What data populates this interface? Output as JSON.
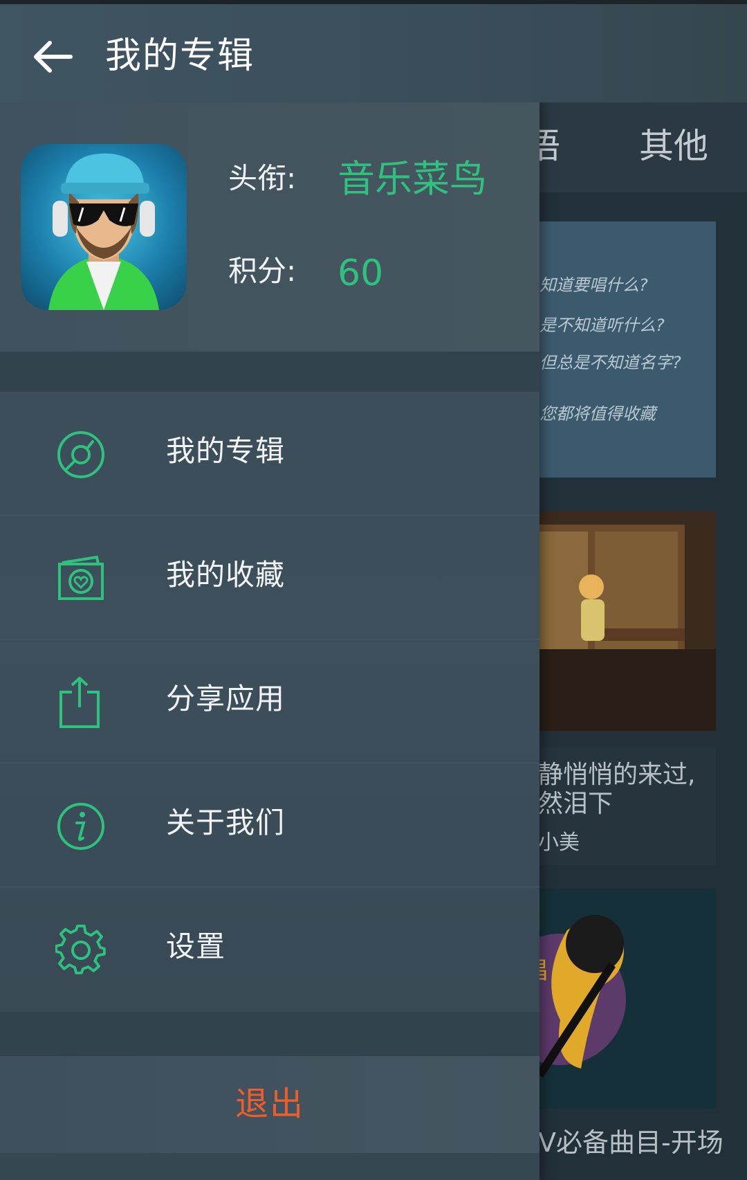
{
  "topbar": {
    "title": "我的专辑"
  },
  "background": {
    "tabs": {
      "partial": "语",
      "other": "其他"
    },
    "card1_lines": [
      "知道要唱什么?",
      "是不知道听什么?",
      "但总是不知道名字?",
      "您都将值得收藏"
    ],
    "card2_lines": [
      "静悄悄的来过,",
      "然泪下",
      "小美"
    ],
    "card3_text": "V必备曲目-开场",
    "card3_badge": "唱"
  },
  "profile": {
    "title_label": "头衔:",
    "title_value": "音乐菜鸟",
    "score_label": "积分:",
    "score_value": "60"
  },
  "menu": {
    "items": [
      {
        "label": "我的专辑",
        "icon": "disc-icon"
      },
      {
        "label": "我的收藏",
        "icon": "favorite-heart-icon"
      },
      {
        "label": "分享应用",
        "icon": "share-icon"
      },
      {
        "label": "关于我们",
        "icon": "info-icon"
      },
      {
        "label": "设置",
        "icon": "gear-icon"
      }
    ]
  },
  "logout": {
    "label": "退出"
  },
  "colors": {
    "accent": "#2ec27e",
    "logout": "#ef5e29"
  }
}
